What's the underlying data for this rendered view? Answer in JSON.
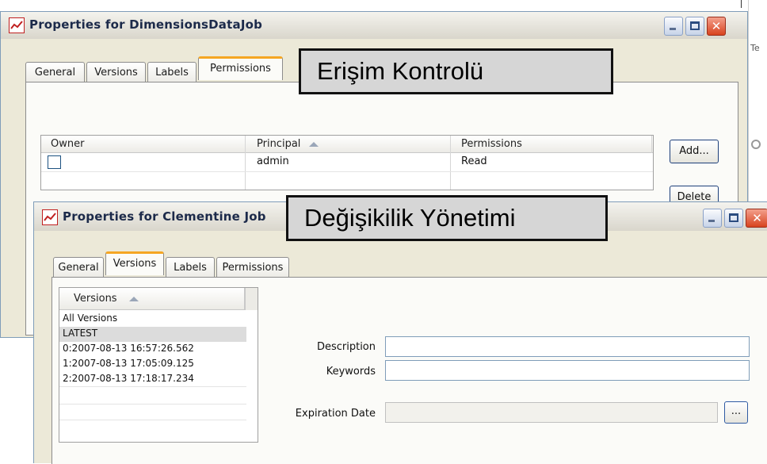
{
  "back_window": {
    "title": "Properties for DimensionsDataJob",
    "tabs": [
      {
        "label": "General",
        "active": false
      },
      {
        "label": "Versions",
        "active": false
      },
      {
        "label": "Labels",
        "active": false
      },
      {
        "label": "Permissions",
        "active": true
      }
    ],
    "table": {
      "columns": [
        "Owner",
        "Principal",
        "Permissions"
      ],
      "sorted_column": "Principal",
      "rows": [
        {
          "owner_checked": false,
          "principal": "admin",
          "permissions": "Read"
        }
      ]
    },
    "buttons": {
      "add": "Add...",
      "delete": "Delete"
    }
  },
  "front_window": {
    "title": "Properties for Clementine Job",
    "tabs": [
      {
        "label": "General",
        "active": false
      },
      {
        "label": "Versions",
        "active": true
      },
      {
        "label": "Labels",
        "active": false
      },
      {
        "label": "Permissions",
        "active": false
      }
    ],
    "versions_list": {
      "header": "Versions",
      "items": [
        {
          "label": "All Versions",
          "selected": false
        },
        {
          "label": "LATEST",
          "selected": true
        },
        {
          "label": "0:2007-08-13 16:57:26.562",
          "selected": false
        },
        {
          "label": "1:2007-08-13 17:05:09.125",
          "selected": false
        },
        {
          "label": "2:2007-08-13 17:18:17.234",
          "selected": false
        }
      ]
    },
    "form": {
      "description_label": "Description",
      "description_value": "",
      "keywords_label": "Keywords",
      "keywords_value": "",
      "expiration_label": "Expiration Date",
      "expiration_value": "",
      "browse_button": "..."
    }
  },
  "overlays": {
    "access_control": "Erişim Kontrolü",
    "change_management": "Değişikilik Yönetimi"
  },
  "background_fragment": {
    "text": "Te"
  },
  "colors": {
    "window_bg": "#ece9d8",
    "tab_active_accent": "#f5a623",
    "close_button": "#d8431f",
    "selection": "#dcdcdc"
  }
}
